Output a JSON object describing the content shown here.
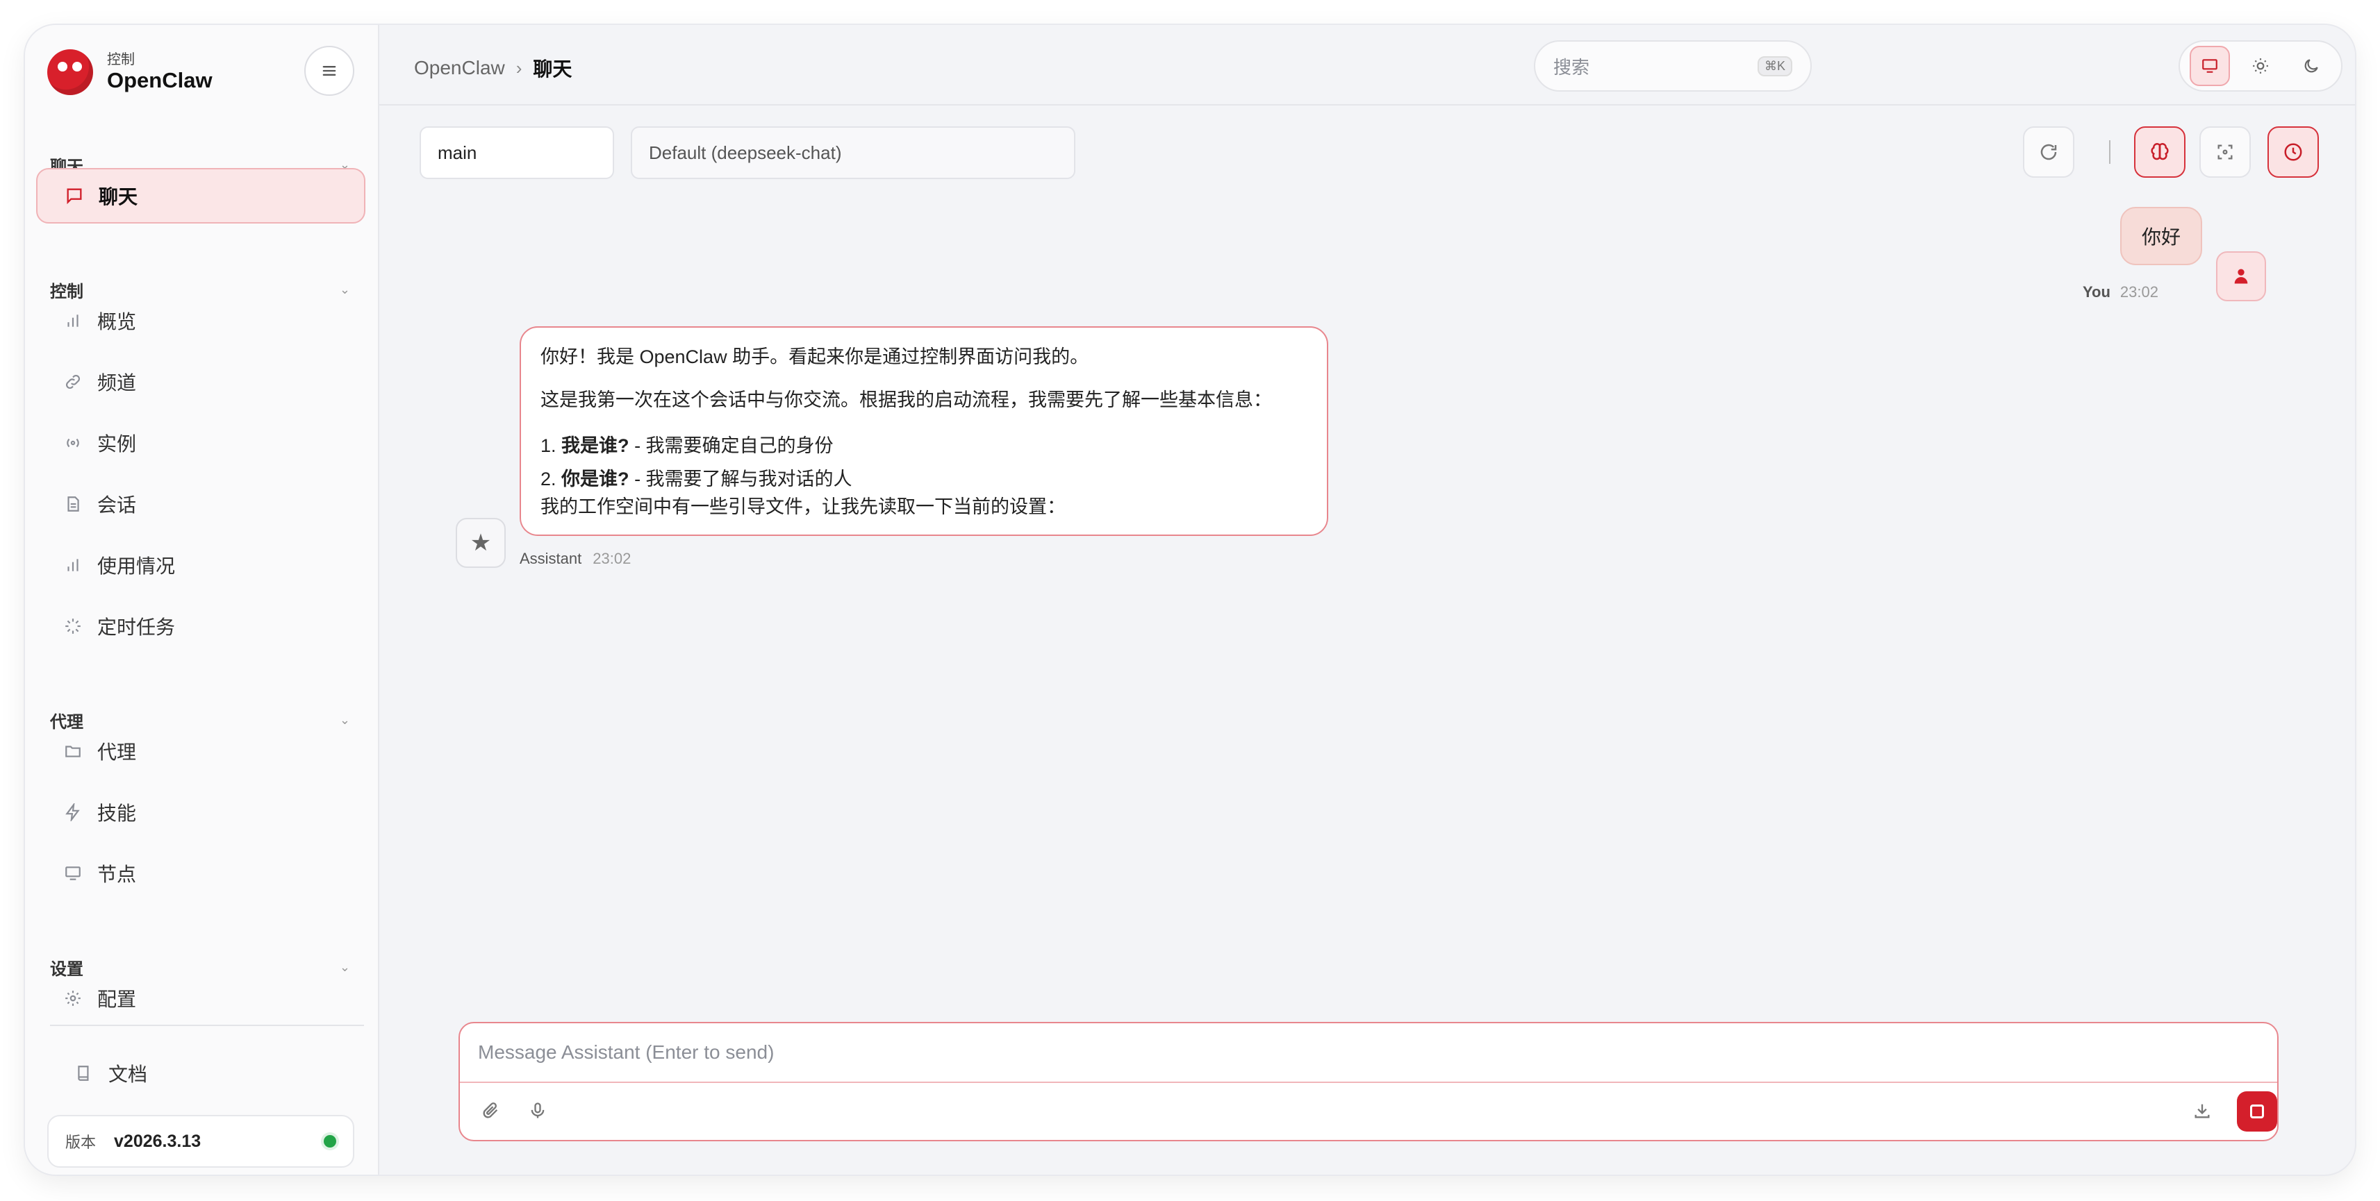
{
  "brand": {
    "subtitle": "控制",
    "name": "OpenClaw"
  },
  "sidebar": {
    "sections": [
      {
        "title": "聊天"
      },
      {
        "title": "控制"
      },
      {
        "title": "代理"
      },
      {
        "title": "设置"
      }
    ],
    "items": [
      {
        "label": "聊天",
        "icon": "message-icon",
        "active": true
      },
      {
        "label": "概览",
        "icon": "bar-chart-icon"
      },
      {
        "label": "频道",
        "icon": "link-icon"
      },
      {
        "label": "实例",
        "icon": "broadcast-icon"
      },
      {
        "label": "会话",
        "icon": "file-icon"
      },
      {
        "label": "使用情况",
        "icon": "bar-chart-icon"
      },
      {
        "label": "定时任务",
        "icon": "spinner-icon"
      },
      {
        "label": "代理",
        "icon": "folder-icon"
      },
      {
        "label": "技能",
        "icon": "bolt-icon"
      },
      {
        "label": "节点",
        "icon": "monitor-icon"
      },
      {
        "label": "配置",
        "icon": "gear-icon"
      },
      {
        "label": "文档",
        "icon": "book-icon"
      }
    ],
    "version": {
      "label": "版本",
      "value": "v2026.3.13",
      "status_color": "#22a447"
    }
  },
  "header": {
    "breadcrumb": {
      "root": "OpenClaw",
      "separator": "›",
      "current": "聊天"
    },
    "search": {
      "placeholder": "搜索",
      "shortcut": "⌘K"
    },
    "theme": {
      "options": [
        "monitor-icon",
        "sun-icon",
        "moon-icon"
      ],
      "selected": "monitor-icon"
    }
  },
  "toolbar": {
    "session": "main",
    "model": "Default (deepseek-chat)",
    "separator": "|",
    "buttons": [
      "refresh-icon",
      "brain-icon",
      "focus-icon",
      "clock-icon"
    ]
  },
  "messages": [
    {
      "role": "user",
      "text": "你好",
      "name": "You",
      "time": "23:02"
    },
    {
      "role": "assistant",
      "name": "Assistant",
      "time": "23:02",
      "para1": "你好！我是 OpenClaw 助手。看起来你是通过控制界面访问我的。",
      "para2": "这是我第一次在这个会话中与你交流。根据我的启动流程，我需要先了解一些基本信息：",
      "list": [
        {
          "num": "1.",
          "bold": "我是谁?",
          "rest": " - 我需要确定自己的身份"
        },
        {
          "num": "2.",
          "bold": "你是谁?",
          "rest": " - 我需要了解与我对话的人"
        }
      ],
      "para3": "我的工作空间中有一些引导文件，让我先读取一下当前的设置："
    }
  ],
  "composer": {
    "placeholder": "Message Assistant (Enter to send)"
  },
  "colors": {
    "accent": "#d41f2b",
    "accent_soft": "#fbe3e4"
  }
}
